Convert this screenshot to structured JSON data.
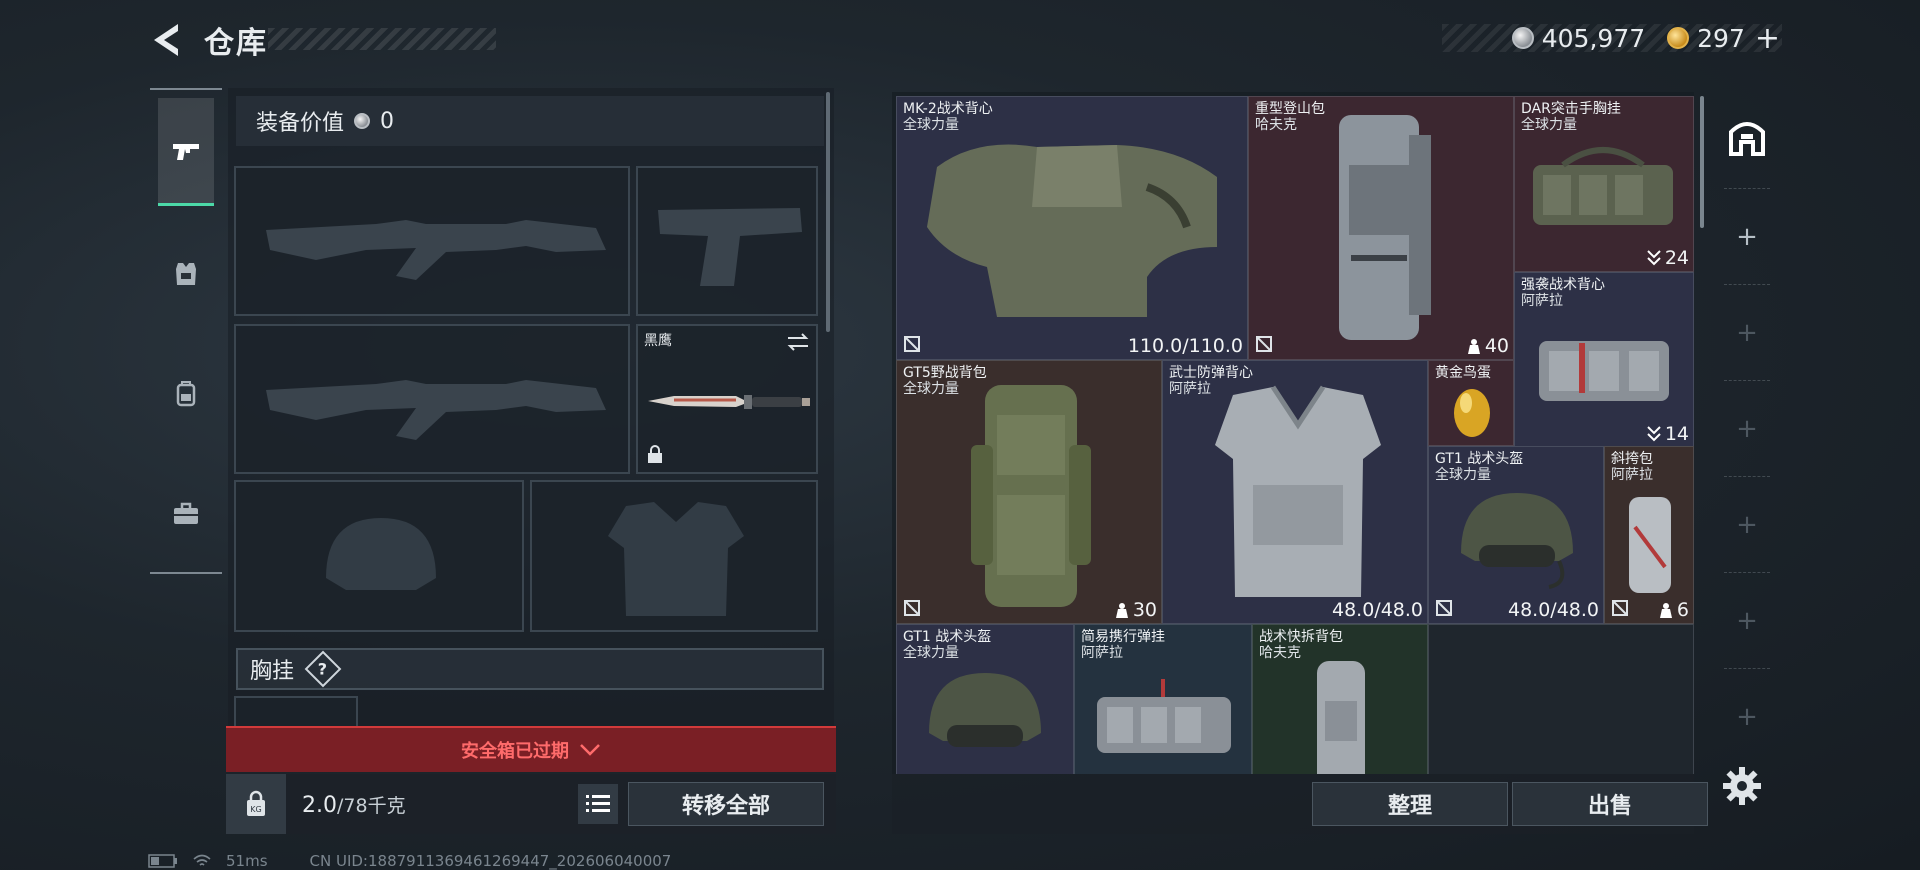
{
  "header": {
    "title": "仓库",
    "silver_amount": "405,977",
    "gold_amount": "297",
    "plus": "+"
  },
  "equipment": {
    "value_label": "装备价值",
    "value": "0",
    "knife_name": "黑鹰",
    "chest_label": "胸挂",
    "help": "?",
    "safe_box_status": "安全箱已过期",
    "weight_current": "2.0",
    "weight_capacity": "/78千克",
    "transfer_all": "转移全部"
  },
  "status_bar": {
    "ping": "51ms",
    "uid": "CN UID:1887911369461269447_20260604000​7"
  },
  "inventory": {
    "items": [
      {
        "name": "MK-2战术背心",
        "brand": "全球力量",
        "durability": "110.0/110.0"
      },
      {
        "name": "重型登山包",
        "brand": "哈夫克",
        "count": "40"
      },
      {
        "name": "DAR突击手胸挂",
        "brand": "全球力量",
        "count": "24"
      },
      {
        "name": "强袭战术背心",
        "brand": "阿萨拉",
        "count": "14"
      },
      {
        "name": "GT5野战背包",
        "brand": "全球力量",
        "count": "30"
      },
      {
        "name": "武士防弹背心",
        "brand": "阿萨拉",
        "durability": "48.0/48.0"
      },
      {
        "name": "黄金鸟蛋",
        "brand": ""
      },
      {
        "name": "GT1 战术头盔",
        "brand": "全球力量",
        "durability": "48.0/48.0"
      },
      {
        "name": "斜挎包",
        "brand": "阿萨拉",
        "count": "6"
      },
      {
        "name": "GT1 战术头盔",
        "brand": "全球力量"
      },
      {
        "name": "简易携行弹挂",
        "brand": "阿萨拉"
      },
      {
        "name": "战术快拆背包",
        "brand": "哈夫克"
      }
    ]
  },
  "actions": {
    "sort": "整理",
    "sell": "出售"
  },
  "colors": {
    "accent_green": "#4cd9a8",
    "alert_red": "#d23a3a",
    "cell_purple": "#2d3046",
    "cell_red": "#3c2730"
  },
  "icons": [
    "back-arrow-icon",
    "silver-coin-icon",
    "gold-coin-icon",
    "pistol-icon",
    "armor-icon",
    "backpack-icon",
    "briefcase-icon",
    "lock-icon",
    "list-icon",
    "swap-icon",
    "broken-durability-icon",
    "weight-icon",
    "stack-icon",
    "storage-icon",
    "settings-icon"
  ]
}
